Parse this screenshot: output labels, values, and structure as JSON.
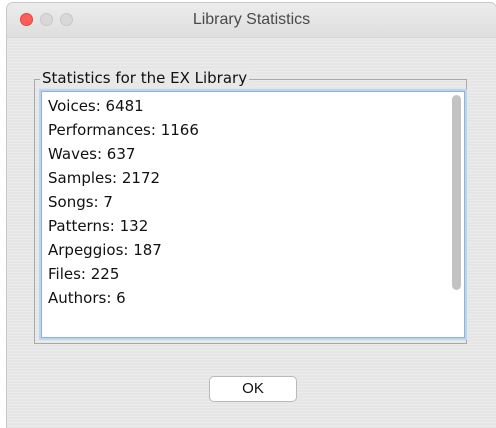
{
  "window": {
    "title": "Library Statistics"
  },
  "group": {
    "title": "Statistics for the EX Library"
  },
  "stats": [
    "Voices: 6481",
    "Performances: 1166",
    "Waves: 637",
    "Samples: 2172",
    "Songs: 7",
    "Patterns: 132",
    "Arpeggios: 187",
    "Files: 225",
    "Authors: 6"
  ],
  "buttons": {
    "ok_label": "OK"
  },
  "colors": {
    "close_button": "#fc5f57",
    "focus_ring": "#bcd4f0"
  }
}
